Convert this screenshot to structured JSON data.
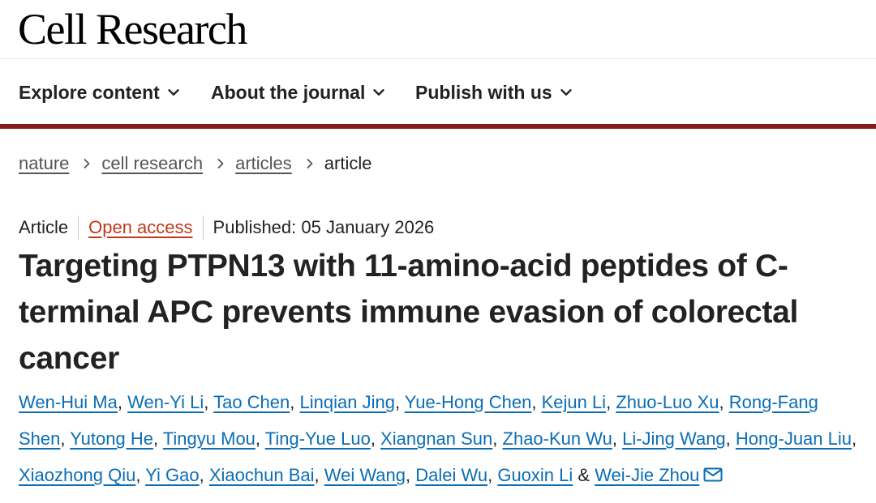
{
  "site": {
    "logo": "Cell Research"
  },
  "nav": {
    "items": [
      {
        "label": "Explore content"
      },
      {
        "label": "About the journal"
      },
      {
        "label": "Publish with us"
      }
    ]
  },
  "breadcrumb": {
    "items": [
      "nature",
      "cell research",
      "articles"
    ],
    "current": "article"
  },
  "article": {
    "type": "Article",
    "access": "Open access",
    "published": "Published: 05 January 2026",
    "title": "Targeting PTPN13 with 11-amino-acid peptides of C-terminal APC prevents immune evasion of colorectal cancer",
    "authors": [
      "Wen-Hui Ma",
      "Wen-Yi Li",
      "Tao Chen",
      "Linqian Jing",
      "Yue-Hong Chen",
      "Kejun Li",
      "Zhuo-Luo Xu",
      "Rong-Fang Shen",
      "Yutong He",
      "Tingyu Mou",
      "Ting-Yue Luo",
      "Xiangnan Sun",
      "Zhao-Kun Wu",
      "Li-Jing Wang",
      "Hong-Juan Liu",
      "Xiaozhong Qiu",
      "Yi Gao",
      "Xiaochun Bai",
      "Wei Wang",
      "Dalei Wu",
      "Guoxin Li",
      "Wei-Jie Zhou"
    ],
    "author_sep": ", ",
    "author_and": " & "
  },
  "colors": {
    "accent_bar": "#8a1b1b",
    "link_blue": "#0b6eb4",
    "open_access": "#c0391b"
  },
  "icons": {
    "nav_chevron": "chevron-down-icon",
    "crumb_sep": "chevron-right-icon",
    "email": "mail-icon"
  }
}
